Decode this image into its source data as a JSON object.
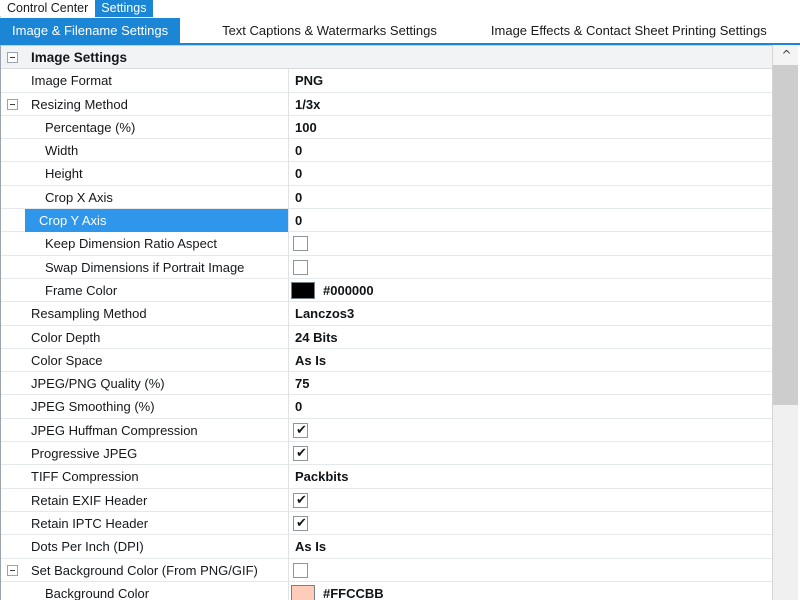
{
  "window_tabs": [
    {
      "label": "Control Center",
      "active": false
    },
    {
      "label": "Settings",
      "active": true
    }
  ],
  "page_tabs": [
    {
      "label": "Image & Filename Settings",
      "active": true
    },
    {
      "label": "Text Captions & Watermarks Settings",
      "active": false
    },
    {
      "label": "Image Effects & Contact Sheet Printing Settings",
      "active": false
    }
  ],
  "scrollbar": {
    "up_arrow_icon": "chevron-up-icon"
  },
  "grid": {
    "rows": [
      {
        "kind": "group",
        "level": 0,
        "expander": "collapse-icon",
        "label": "Image Settings",
        "value_type": "none"
      },
      {
        "kind": "item",
        "level": 0,
        "expander": null,
        "label": "Image Format",
        "value_type": "text",
        "value": "PNG"
      },
      {
        "kind": "item",
        "level": 0,
        "expander": "collapse-icon",
        "label": "Resizing Method",
        "value_type": "text",
        "value": "1/3x"
      },
      {
        "kind": "item",
        "level": 1,
        "expander": null,
        "label": "Percentage (%)",
        "value_type": "text",
        "value": "100"
      },
      {
        "kind": "item",
        "level": 1,
        "expander": null,
        "label": "Width",
        "value_type": "text",
        "value": "0"
      },
      {
        "kind": "item",
        "level": 1,
        "expander": null,
        "label": "Height",
        "value_type": "text",
        "value": "0"
      },
      {
        "kind": "item",
        "level": 1,
        "expander": null,
        "label": "Crop X Axis",
        "value_type": "text",
        "value": "0"
      },
      {
        "kind": "item",
        "level": 1,
        "expander": null,
        "label": "Crop Y Axis",
        "value_type": "text",
        "value": "0",
        "selected": true
      },
      {
        "kind": "item",
        "level": 1,
        "expander": null,
        "label": "Keep Dimension Ratio Aspect",
        "value_type": "checkbox",
        "checked": false
      },
      {
        "kind": "item",
        "level": 1,
        "expander": null,
        "label": "Swap Dimensions if Portrait Image",
        "value_type": "checkbox",
        "checked": false
      },
      {
        "kind": "item",
        "level": 1,
        "expander": null,
        "label": "Frame Color",
        "value_type": "color",
        "value": "#000000",
        "swatch": "#000000"
      },
      {
        "kind": "item",
        "level": 0,
        "expander": null,
        "label": "Resampling Method",
        "value_type": "text",
        "value": "Lanczos3"
      },
      {
        "kind": "item",
        "level": 0,
        "expander": null,
        "label": "Color Depth",
        "value_type": "text",
        "value": "24 Bits"
      },
      {
        "kind": "item",
        "level": 0,
        "expander": null,
        "label": "Color Space",
        "value_type": "text",
        "value": "As Is"
      },
      {
        "kind": "item",
        "level": 0,
        "expander": null,
        "label": "JPEG/PNG Quality (%)",
        "value_type": "text",
        "value": "75"
      },
      {
        "kind": "item",
        "level": 0,
        "expander": null,
        "label": "JPEG Smoothing (%)",
        "value_type": "text",
        "value": "0"
      },
      {
        "kind": "item",
        "level": 0,
        "expander": null,
        "label": "JPEG Huffman Compression",
        "value_type": "checkbox",
        "checked": true
      },
      {
        "kind": "item",
        "level": 0,
        "expander": null,
        "label": "Progressive JPEG",
        "value_type": "checkbox",
        "checked": true
      },
      {
        "kind": "item",
        "level": 0,
        "expander": null,
        "label": "TIFF Compression",
        "value_type": "text",
        "value": "Packbits"
      },
      {
        "kind": "item",
        "level": 0,
        "expander": null,
        "label": "Retain EXIF Header",
        "value_type": "checkbox",
        "checked": true
      },
      {
        "kind": "item",
        "level": 0,
        "expander": null,
        "label": "Retain IPTC Header",
        "value_type": "checkbox",
        "checked": true
      },
      {
        "kind": "item",
        "level": 0,
        "expander": null,
        "label": "Dots Per Inch (DPI)",
        "value_type": "text",
        "value": "As Is"
      },
      {
        "kind": "item",
        "level": 0,
        "expander": "collapse-icon",
        "label": "Set Background Color (From PNG/GIF)",
        "value_type": "checkbox",
        "checked": false
      },
      {
        "kind": "item",
        "level": 1,
        "expander": null,
        "label": "Background Color",
        "value_type": "color",
        "value": "#FFCCBB",
        "swatch": "#FFCCBB"
      }
    ]
  },
  "colors": {
    "accent": "#1c86d6",
    "selection": "#2f97eb",
    "group_header_bg": "#f1f3f5"
  }
}
